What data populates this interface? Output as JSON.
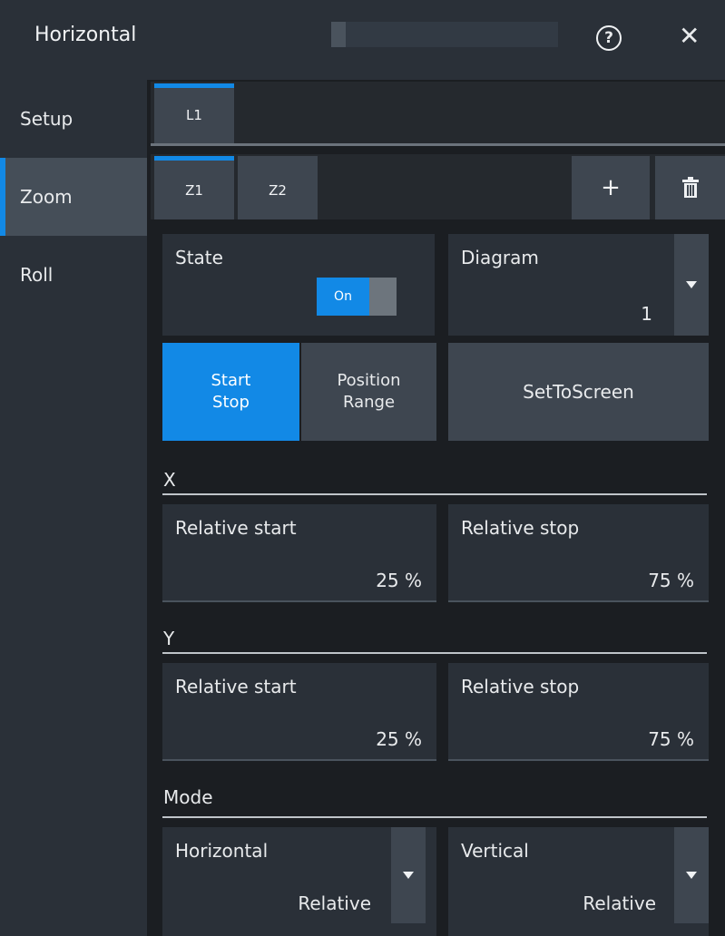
{
  "header": {
    "title": "Horizontal",
    "help_glyph": "?",
    "close_glyph": "✕"
  },
  "sidebar": {
    "items": [
      {
        "label": "Setup",
        "active": false
      },
      {
        "label": "Zoom",
        "active": true
      },
      {
        "label": "Roll",
        "active": false
      }
    ]
  },
  "tabs_l": {
    "items": [
      "L1"
    ]
  },
  "tabs_z": {
    "items": [
      "Z1",
      "Z2"
    ],
    "add_glyph": "+",
    "delete_icon": "trash-icon"
  },
  "state": {
    "label": "State",
    "toggle_text": "On"
  },
  "diagram": {
    "label": "Diagram",
    "value": "1"
  },
  "mode_buttons": {
    "start_stop": [
      "Start",
      "Stop"
    ],
    "position_range": [
      "Position",
      "Range"
    ],
    "set_to_screen": "SetToScreen"
  },
  "x": {
    "title": "X",
    "rel_start": {
      "label": "Relative start",
      "value": "25 %"
    },
    "rel_stop": {
      "label": "Relative stop",
      "value": "75 %"
    }
  },
  "y": {
    "title": "Y",
    "rel_start": {
      "label": "Relative start",
      "value": "25 %"
    },
    "rel_stop": {
      "label": "Relative stop",
      "value": "75 %"
    }
  },
  "mode": {
    "title": "Mode",
    "horizontal": {
      "label": "Horizontal",
      "value": "Relative"
    },
    "vertical": {
      "label": "Vertical",
      "value": "Relative"
    }
  },
  "colors": {
    "accent": "#1289e6",
    "panel": "#2a3038",
    "background": "#1b1e22"
  }
}
